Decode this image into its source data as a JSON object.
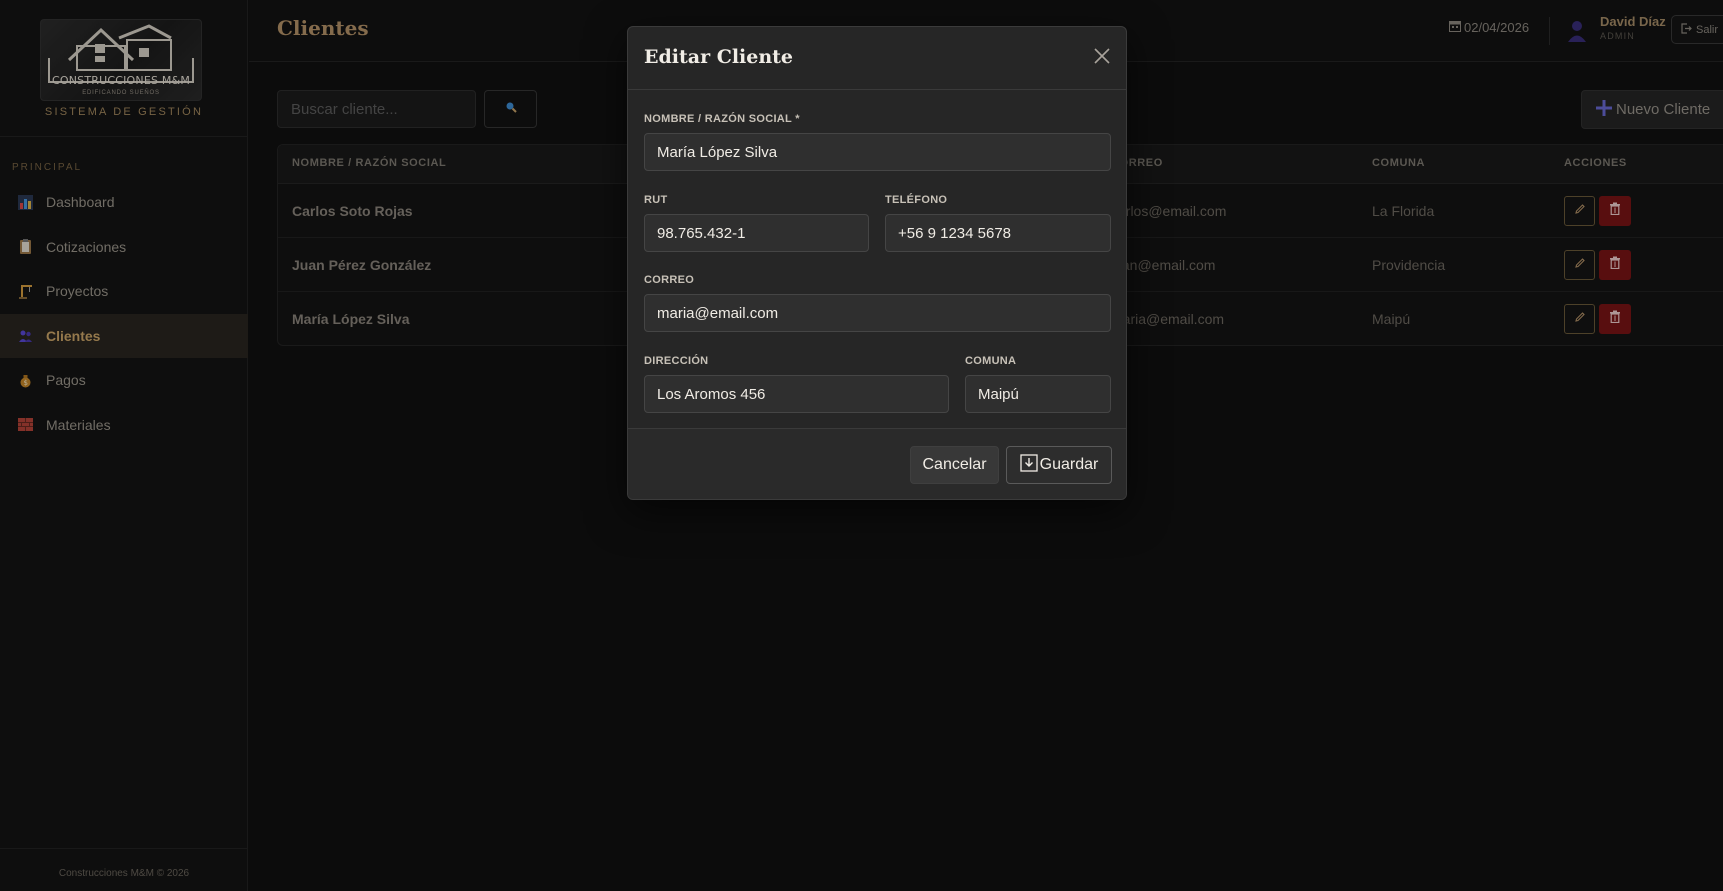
{
  "sidebar": {
    "logo_text": "CONSTRUCCIONES M&M",
    "logo_subtext": "EDIFICANDO SUEÑOS",
    "system_title": "SISTEMA DE GESTIÓN",
    "section_label": "PRINCIPAL",
    "items": [
      {
        "label": "Dashboard",
        "icon": "bar-chart-icon"
      },
      {
        "label": "Cotizaciones",
        "icon": "clipboard-icon"
      },
      {
        "label": "Proyectos",
        "icon": "crane-icon"
      },
      {
        "label": "Clientes",
        "icon": "users-icon",
        "active": true
      },
      {
        "label": "Pagos",
        "icon": "money-bag-icon"
      },
      {
        "label": "Materiales",
        "icon": "bricks-icon"
      }
    ],
    "footer": "Construcciones M&M © 2026"
  },
  "header": {
    "title": "Clientes",
    "date": "02/04/2026",
    "user_name": "David Díaz",
    "user_role": "ADMIN",
    "logout_label": "Salir"
  },
  "toolbar": {
    "search_placeholder": "Buscar cliente...",
    "new_button_label": "Nuevo Cliente"
  },
  "table": {
    "columns": {
      "name": "NOMBRE / RAZÓN SOCIAL",
      "email": "CORREO",
      "comuna": "COMUNA",
      "actions": "ACCIONES"
    },
    "rows": [
      {
        "name": "Carlos Soto Rojas",
        "email": "carlos@email.com",
        "comuna": "La Florida"
      },
      {
        "name": "Juan Pérez González",
        "email": "juan@email.com",
        "comuna": "Providencia"
      },
      {
        "name": "María López Silva",
        "email": "maria@email.com",
        "comuna": "Maipú"
      }
    ]
  },
  "modal": {
    "title": "Editar Cliente",
    "fields": {
      "name": {
        "label": "NOMBRE / RAZÓN SOCIAL *",
        "value": "María López Silva"
      },
      "rut": {
        "label": "RUT",
        "value": "98.765.432-1"
      },
      "phone": {
        "label": "TELÉFONO",
        "value": "+56 9 1234 5678"
      },
      "email": {
        "label": "CORREO",
        "value": "maria@email.com"
      },
      "address": {
        "label": "DIRECCIÓN",
        "value": "Los Aromos 456"
      },
      "comuna": {
        "label": "COMUNA",
        "value": "Maipú"
      }
    },
    "cancel_label": "Cancelar",
    "save_label": "Guardar"
  },
  "colors": {
    "accent": "#b8956a",
    "background": "#111111",
    "modal": "#262626",
    "danger": "#7a1416"
  }
}
